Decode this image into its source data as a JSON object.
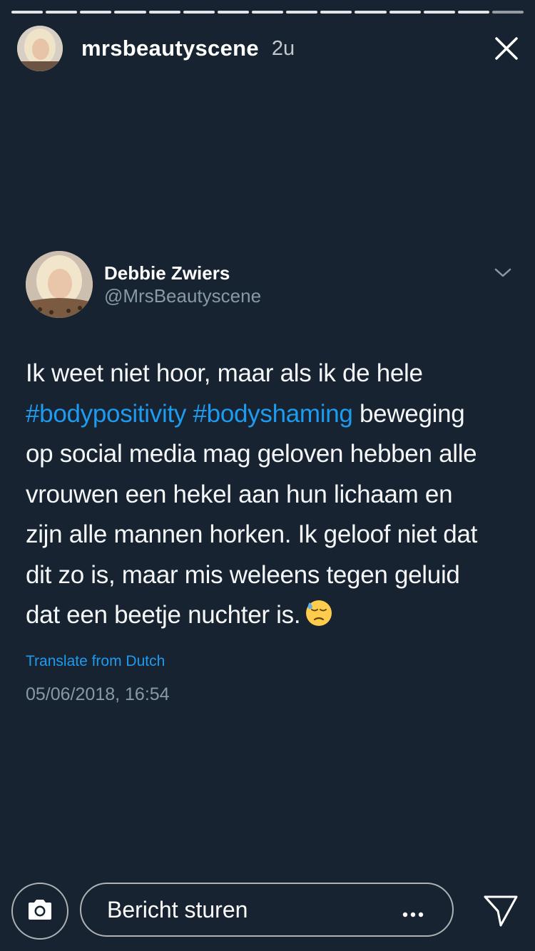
{
  "story": {
    "username": "mrsbeautyscene",
    "age": "2u",
    "segments": 15
  },
  "tweet": {
    "author_name": "Debbie Zwiers",
    "author_handle": "@MrsBeautyscene",
    "line1": "Ik weet niet hoor, maar als ik  de hele",
    "hashtag1": "#bodypositivity",
    "hashtag2": "#bodyshaming",
    "line2_rest": " beweging",
    "line3": "op social media mag geloven hebben alle",
    "line4": "vrouwen een hekel aan hun lichaam en",
    "line5": "zijn alle mannen horken. Ik geloof niet dat",
    "line6": "dit zo is, maar mis weleens tegen geluid",
    "line7": "dat een beetje nuchter is.",
    "translate": "Translate from Dutch",
    "timestamp": "05/06/2018, 16:54"
  },
  "footer": {
    "message_placeholder": "Bericht sturen"
  },
  "icons": {
    "close": "close-icon",
    "chevron": "chevron-down-icon",
    "camera": "camera-icon",
    "more": "more-icon",
    "send": "send-icon",
    "emoji": "downcast-face-with-sweat-emoji"
  },
  "colors": {
    "background": "#172330",
    "hashtag": "#1d9bf0",
    "secondary_text": "#8899a6"
  }
}
